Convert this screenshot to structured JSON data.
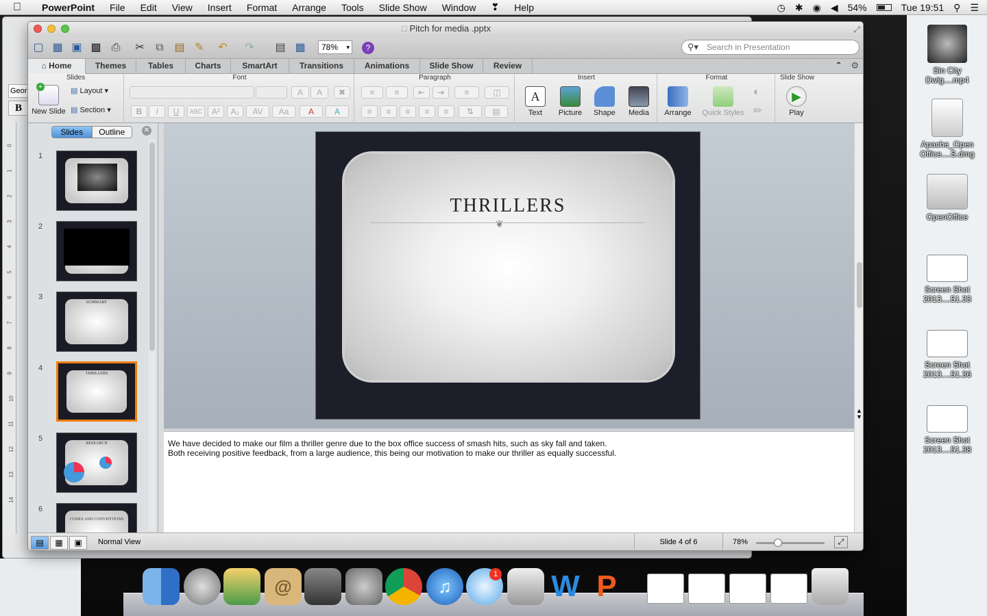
{
  "menubar": {
    "apple": "",
    "app": "PowerPoint",
    "items": [
      "File",
      "Edit",
      "View",
      "Insert",
      "Format",
      "Arrange",
      "Tools",
      "Slide Show",
      "Window",
      "Help"
    ],
    "battery": "54%",
    "clock": "Tue 19:51"
  },
  "window": {
    "title": "Pitch for media .pptx"
  },
  "toolbar": {
    "zoom": "78%",
    "search_placeholder": "Search in Presentation"
  },
  "tabs": [
    "Home",
    "Themes",
    "Tables",
    "Charts",
    "SmartArt",
    "Transitions",
    "Animations",
    "Slide Show",
    "Review"
  ],
  "ribbon": {
    "groups": {
      "slides": "Slides",
      "font": "Font",
      "paragraph": "Paragraph",
      "insert": "Insert",
      "format": "Format",
      "slideshow": "Slide Show"
    },
    "new_slide": "New Slide",
    "layout": "Layout",
    "section": "Section",
    "insert_buttons": [
      "Text",
      "Picture",
      "Shape",
      "Media"
    ],
    "format_buttons": [
      "Arrange",
      "Quick Styles"
    ],
    "play": "Play"
  },
  "bg_window": {
    "font_name": "Geor",
    "bold": "B"
  },
  "left_panel": {
    "tab_slides": "Slides",
    "tab_outline": "Outline",
    "thumbs": [
      {
        "n": "1",
        "title": ""
      },
      {
        "n": "2",
        "title": ""
      },
      {
        "n": "3",
        "title": "SUMMARY"
      },
      {
        "n": "4",
        "title": "THRILLERS"
      },
      {
        "n": "5",
        "title": "RESEARCH"
      },
      {
        "n": "6",
        "title": "CODES AND CONVENTIONS"
      }
    ]
  },
  "slide": {
    "title": "THRILLERS"
  },
  "notes": {
    "line1": "We have decided to make our film a thriller genre due to the box office success of smash hits, such as sky fall and taken.",
    "line2": "Both receiving positive feedback, from a large audience, this being our motivation to make our thriller as equally successful."
  },
  "status": {
    "view": "Normal View",
    "slide_count": "Slide 4 of 6",
    "zoom": "78%",
    "zoom_level": 0.3
  },
  "desktop_icons": [
    "Sin City Dwig....mp4",
    "Apache_Open Office....S.dmg",
    "OpenOffice",
    "Screen Shot 2013....51.33",
    "Screen Shot 2013....51.36",
    "Screen Shot 2013....51.38"
  ],
  "dock": [
    {
      "name": "finder",
      "label": ""
    },
    {
      "name": "launchpad",
      "label": ""
    },
    {
      "name": "photos",
      "label": ""
    },
    {
      "name": "contacts",
      "label": "@"
    },
    {
      "name": "facetime",
      "label": ""
    },
    {
      "name": "system-prefs",
      "label": ""
    },
    {
      "name": "chrome",
      "label": ""
    },
    {
      "name": "itunes",
      "label": "♫"
    },
    {
      "name": "messages",
      "label": ""
    },
    {
      "name": "utilities",
      "label": ""
    },
    {
      "name": "word",
      "label": "W"
    },
    {
      "name": "powerpoint",
      "label": "P"
    },
    {
      "name": "doc1",
      "label": ""
    },
    {
      "name": "doc2",
      "label": ""
    },
    {
      "name": "doc3",
      "label": ""
    },
    {
      "name": "doc4",
      "label": ""
    },
    {
      "name": "trash",
      "label": ""
    }
  ],
  "dock_badge": "1"
}
